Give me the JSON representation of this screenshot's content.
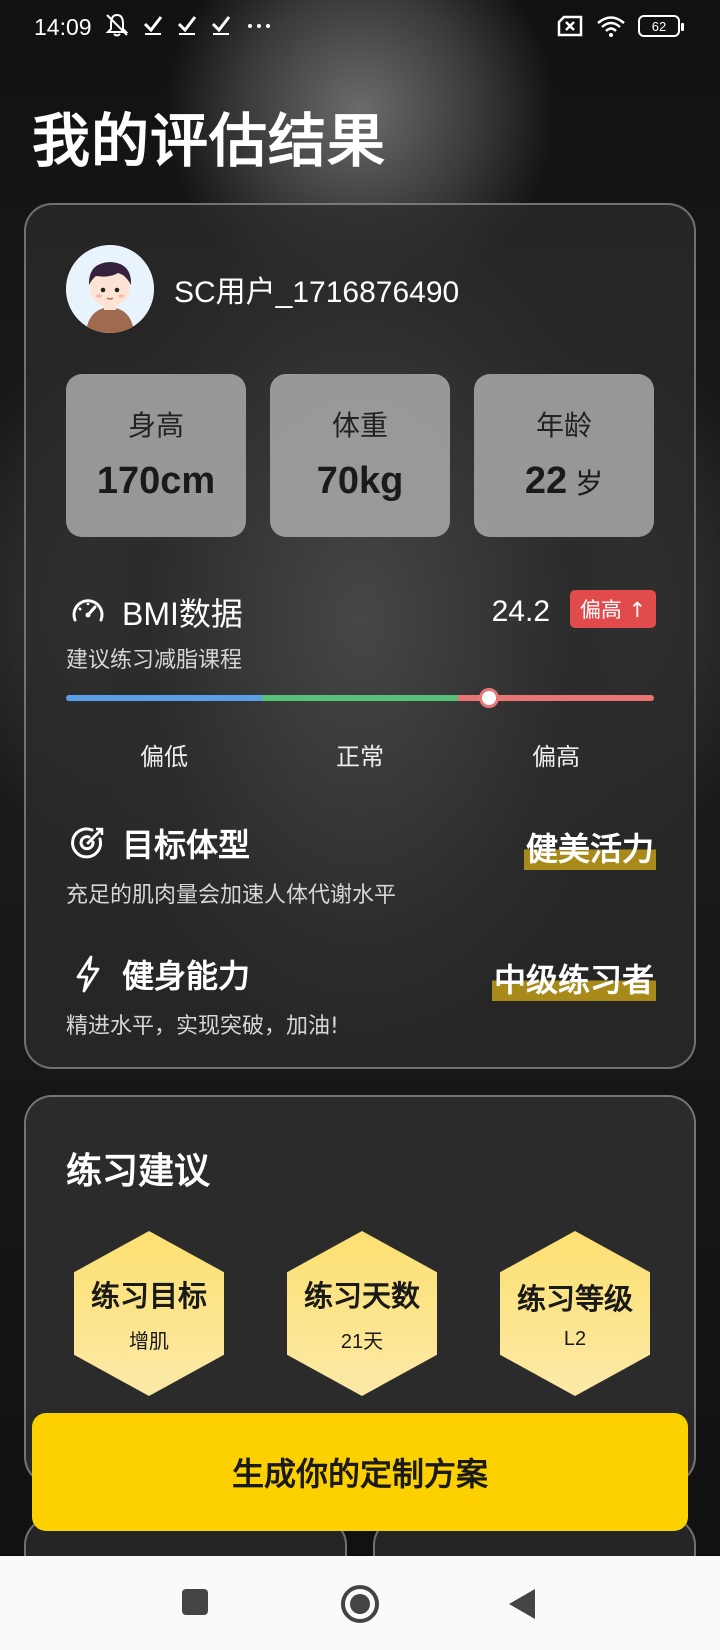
{
  "status_bar": {
    "time": "14:09",
    "battery": "62",
    "icons_left": [
      "bell-off-icon",
      "check-icon",
      "check-icon",
      "check-icon",
      "more-icon"
    ],
    "icons_right": [
      "sim-off-icon",
      "wifi-icon",
      "battery-icon"
    ]
  },
  "page": {
    "title": "我的评估结果"
  },
  "profile": {
    "username": "SC用户_1716876490",
    "stats": [
      {
        "label": "身高",
        "value": "170cm",
        "unit": ""
      },
      {
        "label": "体重",
        "value": "70kg",
        "unit": ""
      },
      {
        "label": "年龄",
        "value": "22",
        "unit": "岁"
      }
    ]
  },
  "bmi": {
    "title": "BMI数据",
    "subtitle": "建议练习减脂课程",
    "value": "24.2",
    "badge": "偏高 ↑",
    "level_fraction": 0.72,
    "scale_labels": [
      "偏低",
      "正常",
      "偏高"
    ],
    "colors": {
      "low": "#5aa0e6",
      "normal": "#58c07a",
      "high": "#e97575",
      "badge": "#e24b4b"
    }
  },
  "target": {
    "title": "目标体型",
    "subtitle": "充足的肌肉量会加速人体代谢水平",
    "value": "健美活力"
  },
  "ability": {
    "title": "健身能力",
    "subtitle": "精进水平，实现突破，加油!",
    "value": "中级练习者"
  },
  "advice": {
    "title": "练习建议",
    "items": [
      {
        "label": "练习目标",
        "value": "增肌"
      },
      {
        "label": "练习天数",
        "value": "21天"
      },
      {
        "label": "练习等级",
        "value": "L2"
      }
    ]
  },
  "cta": {
    "label": "生成你的定制方案",
    "color": "#fdd100"
  },
  "nav": {
    "buttons": [
      "recent-apps-icon",
      "home-icon",
      "back-icon"
    ]
  }
}
